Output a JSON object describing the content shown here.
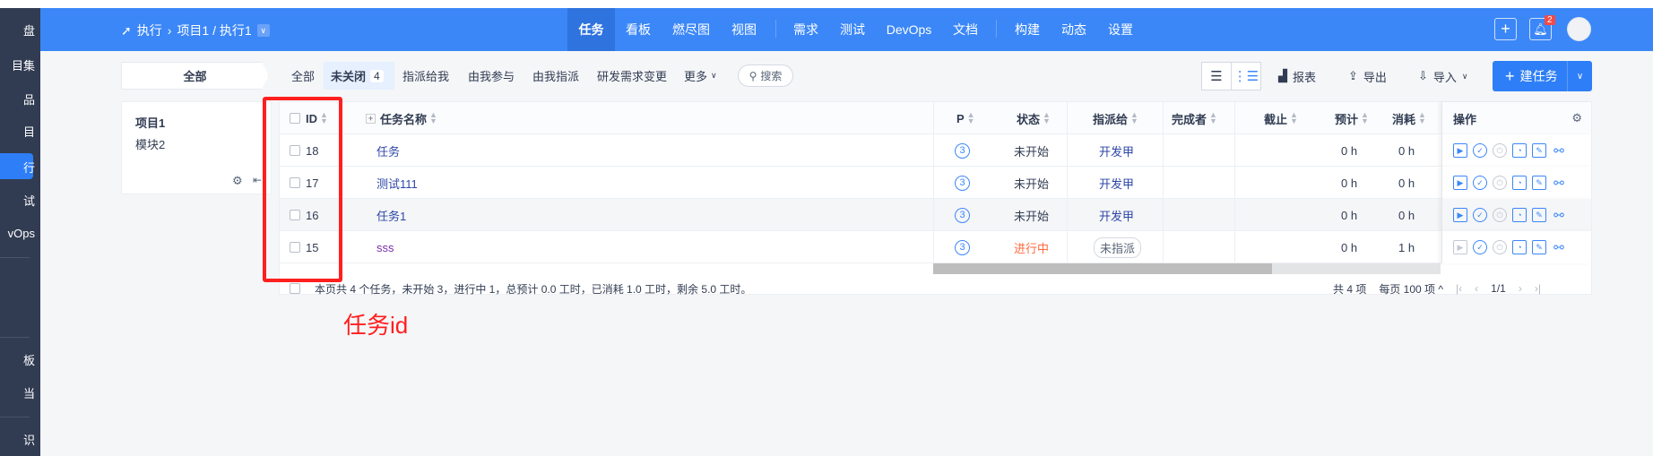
{
  "sidebar": {
    "items": [
      "盘",
      "目集",
      "品",
      "目",
      "行",
      "试",
      "vOps",
      "板",
      "当",
      "识"
    ],
    "active_index": 4
  },
  "header": {
    "breadcrumb": {
      "module": "执行",
      "path": "项目1 / 执行1"
    },
    "nav": [
      "任务",
      "看板",
      "燃尽图",
      "视图",
      "需求",
      "测试",
      "DevOps",
      "文档",
      "构建",
      "动态",
      "设置"
    ],
    "active_nav": "任务",
    "notification_count": "2",
    "colors": {
      "brand": "#3b87f8",
      "sidebar": "#313c52"
    }
  },
  "filter": {
    "module_all": "全部",
    "tabs": [
      "全部",
      "未关闭",
      "指派给我",
      "由我参与",
      "由我指派",
      "研发需求变更",
      "更多"
    ],
    "unclosed_count": "4",
    "search_label": "搜索"
  },
  "toolbar": {
    "report": "报表",
    "export": "导出",
    "import": "导入",
    "create": "建任务"
  },
  "module_panel": {
    "project": "项目1",
    "module": "模块2"
  },
  "table": {
    "headers": {
      "id": "ID",
      "name": "任务名称",
      "pri": "P",
      "status": "状态",
      "assigned": "指派给",
      "finished_by": "完成者",
      "deadline": "截止",
      "estimate": "预计",
      "consumed": "消耗",
      "actions": "操作"
    },
    "rows": [
      {
        "id": "18",
        "name": "任务",
        "pri": "3",
        "status": "未开始",
        "assigned": "开发甲",
        "finished_by": "",
        "deadline": "",
        "estimate": "0 h",
        "consumed": "0 h"
      },
      {
        "id": "17",
        "name": "测试111",
        "pri": "3",
        "status": "未开始",
        "assigned": "开发甲",
        "finished_by": "",
        "deadline": "",
        "estimate": "0 h",
        "consumed": "0 h"
      },
      {
        "id": "16",
        "name": "任务1",
        "pri": "3",
        "status": "未开始",
        "assigned": "开发甲",
        "finished_by": "",
        "deadline": "",
        "estimate": "0 h",
        "consumed": "0 h"
      },
      {
        "id": "15",
        "name": "sss",
        "pri": "3",
        "status": "进行中",
        "assigned": "未指派",
        "finished_by": "",
        "deadline": "",
        "estimate": "0 h",
        "consumed": "1 h"
      }
    ],
    "summary": "本页共 4 个任务，未开始 3，进行中 1，总预计 0.0 工时，已消耗 1.0 工时，剩余 5.0 工时。",
    "pager": {
      "total": "共 4 项",
      "per_page": "每页 100 项",
      "page": "1/1"
    }
  },
  "annotation": {
    "label": "任务id",
    "color": "#ff1f1f"
  }
}
